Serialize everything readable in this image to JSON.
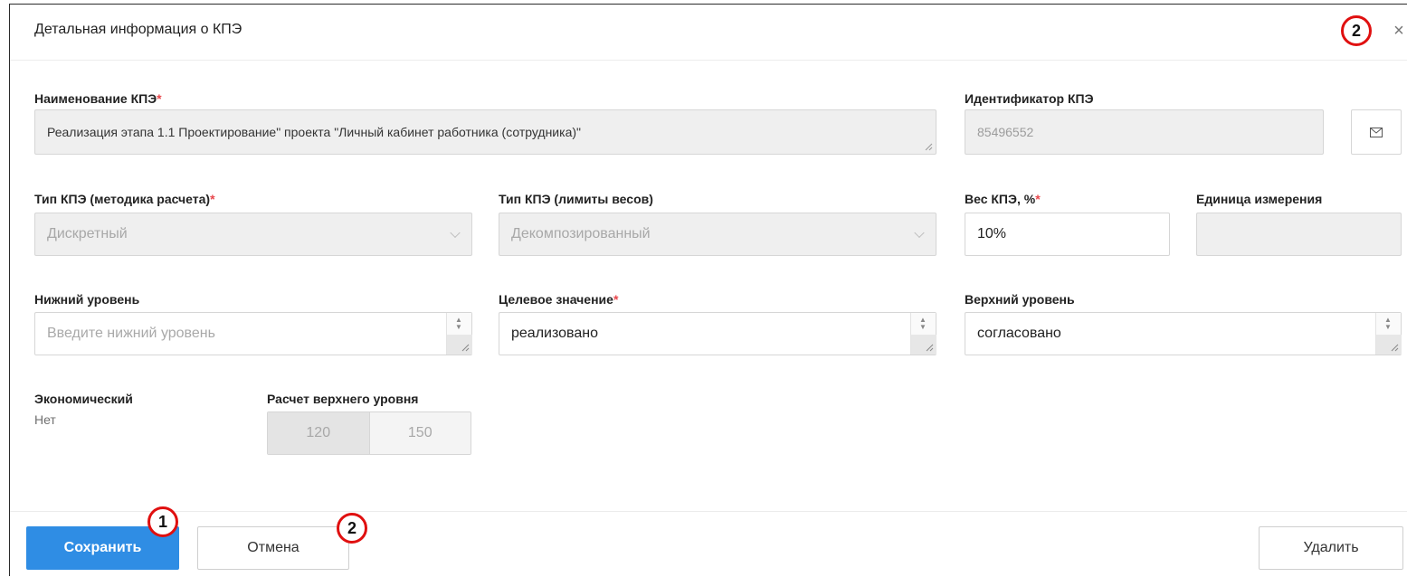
{
  "dialog": {
    "title": "Детальная информация о КПЭ",
    "close_glyph": "×"
  },
  "fields": {
    "name": {
      "label": "Наименование КПЭ",
      "required_mark": "*",
      "value": "Реализация этапа 1.1 Проектирование\" проекта \"Личный кабинет работника (сотрудника)\""
    },
    "identifier": {
      "label": "Идентификатор КПЭ",
      "value": "85496552"
    },
    "calc_type": {
      "label": "Тип КПЭ (методика расчета)",
      "required_mark": "*",
      "value": "Дискретный"
    },
    "weight_limit_type": {
      "label": "Тип КПЭ (лимиты весов)",
      "value": "Декомпозированный"
    },
    "weight": {
      "label": "Вес КПЭ, %",
      "required_mark": "*",
      "value": "10%"
    },
    "unit": {
      "label": "Единица измерения",
      "value": ""
    },
    "lower_level": {
      "label": "Нижний уровень",
      "placeholder": "Введите нижний уровень"
    },
    "target_value": {
      "label": "Целевое значение",
      "required_mark": "*",
      "value": "реализовано"
    },
    "upper_level": {
      "label": "Верхний уровень",
      "value": "согласовано"
    },
    "economic": {
      "label": "Экономический",
      "value": "Нет"
    },
    "upper_calc": {
      "label": "Расчет верхнего уровня",
      "options": [
        "120",
        "150"
      ],
      "selected": "120"
    }
  },
  "footer": {
    "save_label": "Сохранить",
    "cancel_label": "Отмена",
    "delete_label": "Удалить"
  },
  "annotations": {
    "badge_save": "1",
    "badge_cancel": "2",
    "badge_close": "2",
    "badge_color": "#e01010"
  },
  "colors": {
    "primary": "#2f8de4",
    "required": "#e8474c",
    "disabled_bg": "#efefef"
  },
  "icons": {
    "identifier_action": "mail-icon",
    "select_arrow": "chevron-down-icon",
    "close": "close-icon"
  }
}
